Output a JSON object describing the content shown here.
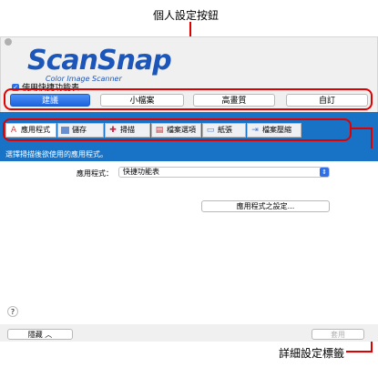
{
  "callouts": {
    "top": "個人設定按鈕",
    "bottom": "詳細設定標籤"
  },
  "logo": {
    "main": "ScanSnap",
    "sub": "Color Image Scanner"
  },
  "quick_menu_checkbox": {
    "label": "使用快捷功能表",
    "checked": true
  },
  "profiles": [
    {
      "label": "建議",
      "active": true
    },
    {
      "label": "小檔案",
      "active": false
    },
    {
      "label": "高畫質",
      "active": false
    },
    {
      "label": "自訂",
      "active": false
    }
  ],
  "tabs": [
    {
      "label": "應用程式",
      "icon": "app-icon"
    },
    {
      "label": "儲存",
      "icon": "save-icon"
    },
    {
      "label": "掃描",
      "icon": "scan-icon"
    },
    {
      "label": "檔案選項",
      "icon": "file-option-icon"
    },
    {
      "label": "紙張",
      "icon": "paper-icon"
    },
    {
      "label": "檔案壓縮",
      "icon": "compression-icon"
    }
  ],
  "panel": {
    "heading": "選擇掃描後欲使用的應用程式。",
    "app_label": "應用程式：",
    "app_value": "快捷功能表",
    "app_settings_button": "應用程式之設定..."
  },
  "footer": {
    "help": "?",
    "hide_button": "隱藏",
    "apply_button": "套用"
  },
  "colors": {
    "accent": "#1873c7",
    "callout": "#e00000"
  }
}
